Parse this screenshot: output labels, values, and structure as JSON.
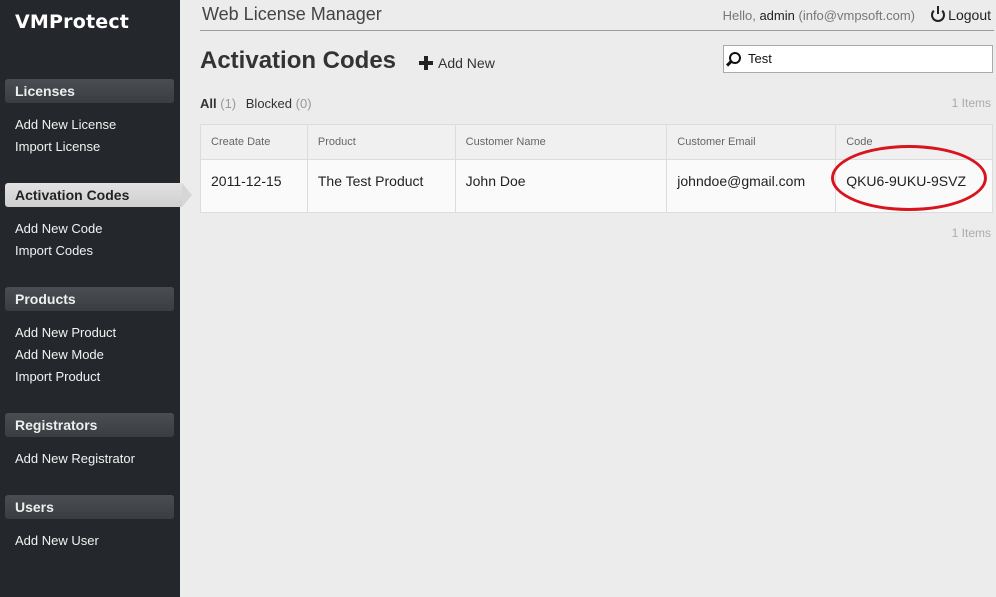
{
  "sidebar": {
    "brand": "VMProtect",
    "sections": [
      {
        "header": "Licenses",
        "links": [
          "Add New License",
          "Import License"
        ]
      },
      {
        "header": "Activation Codes",
        "links": [
          "Add New Code",
          "Import Codes"
        ],
        "active": true
      },
      {
        "header": "Products",
        "links": [
          "Add New Product",
          "Add New Mode",
          "Import Product"
        ]
      },
      {
        "header": "Registrators",
        "links": [
          "Add New Registrator"
        ]
      },
      {
        "header": "Users",
        "links": [
          "Add New User"
        ]
      }
    ]
  },
  "header": {
    "app_title": "Web License Manager",
    "hello": "Hello,",
    "username": "admin",
    "email": "(info@vmpsoft.com)",
    "logout": "Logout"
  },
  "page": {
    "title": "Activation Codes",
    "add_new": "Add New",
    "search_value": "Test",
    "filters": {
      "all": "All",
      "all_count": "(1)",
      "blocked": "Blocked",
      "blocked_count": "(0)"
    },
    "items_count_top": "1 Items",
    "items_count_bottom": "1 Items"
  },
  "table": {
    "columns": [
      "Create Date",
      "Product",
      "Customer Name",
      "Customer Email",
      "Code"
    ],
    "rows": [
      [
        "2011-12-15",
        "The Test Product",
        "John Doe",
        "johndoe@gmail.com",
        "QKU6-9UKU-9SVZ"
      ]
    ]
  },
  "colors": {
    "sidebar_bg": "#24272b",
    "highlight_ring": "#d8141c"
  }
}
